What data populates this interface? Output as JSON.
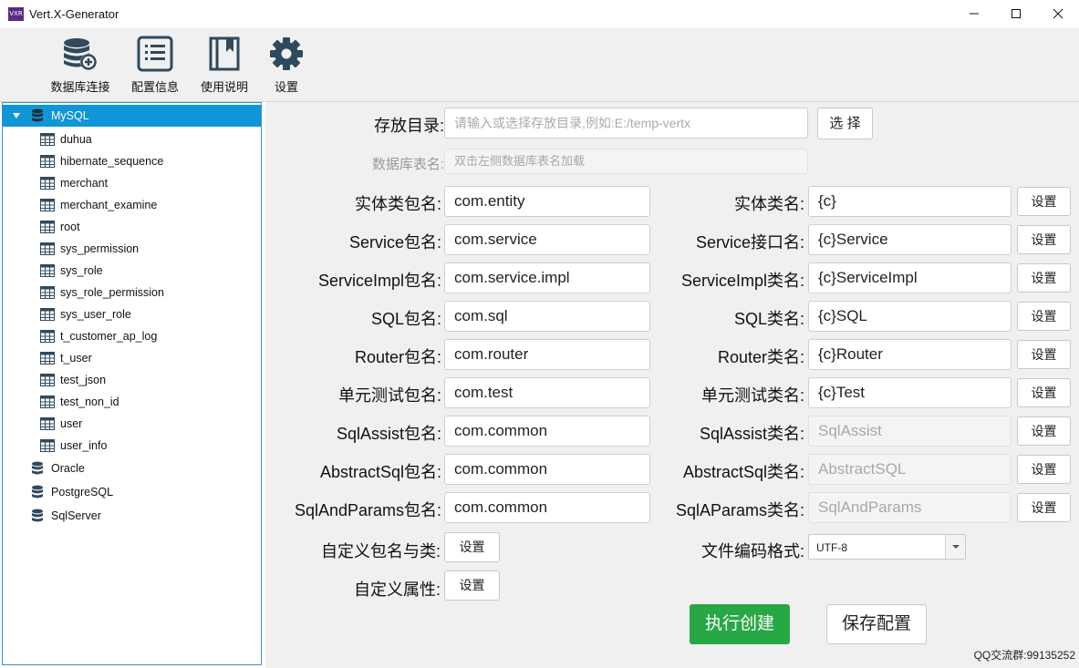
{
  "window": {
    "title": "Vert.X-Generator",
    "logo_text": "VXR"
  },
  "toolbar": [
    {
      "label": "数据库连接",
      "icon": "database-add-icon"
    },
    {
      "label": "配置信息",
      "icon": "list-icon"
    },
    {
      "label": "使用说明",
      "icon": "book-icon"
    },
    {
      "label": "设置",
      "icon": "gear-icon"
    }
  ],
  "tree": {
    "root": "MySQL",
    "tables": [
      "duhua",
      "hibernate_sequence",
      "merchant",
      "merchant_examine",
      "root",
      "sys_permission",
      "sys_role",
      "sys_role_permission",
      "sys_user_role",
      "t_customer_ap_log",
      "t_user",
      "test_json",
      "test_non_id",
      "user",
      "user_info"
    ],
    "others": [
      "Oracle",
      "PostgreSQL",
      "SqlServer"
    ]
  },
  "form": {
    "dir_label": "存放目录:",
    "dir_placeholder": "请输入或选择存放目录,例如:E:/temp-vertx",
    "choose_btn": "选 择",
    "table_label": "数据库表名:",
    "table_placeholder": "双击左侧数据库表名加载",
    "rows": [
      {
        "pkg_label": "实体类包名:",
        "pkg_value": "com.entity",
        "cls_label": "实体类名:",
        "cls_value": "{c}",
        "cls_disabled": false
      },
      {
        "pkg_label": "Service包名:",
        "pkg_value": "com.service",
        "cls_label": "Service接口名:",
        "cls_value": "{c}Service",
        "cls_disabled": false
      },
      {
        "pkg_label": "ServiceImpl包名:",
        "pkg_value": "com.service.impl",
        "cls_label": "ServiceImpl类名:",
        "cls_value": "{c}ServiceImpl",
        "cls_disabled": false
      },
      {
        "pkg_label": "SQL包名:",
        "pkg_value": "com.sql",
        "cls_label": "SQL类名:",
        "cls_value": "{c}SQL",
        "cls_disabled": false
      },
      {
        "pkg_label": "Router包名:",
        "pkg_value": "com.router",
        "cls_label": "Router类名:",
        "cls_value": "{c}Router",
        "cls_disabled": false
      },
      {
        "pkg_label": "单元测试包名:",
        "pkg_value": "com.test",
        "cls_label": "单元测试类名:",
        "cls_value": "{c}Test",
        "cls_disabled": false
      },
      {
        "pkg_label": "SqlAssist包名:",
        "pkg_value": "com.common",
        "cls_label": "SqlAssist类名:",
        "cls_value": "SqlAssist",
        "cls_disabled": true
      },
      {
        "pkg_label": "AbstractSql包名:",
        "pkg_value": "com.common",
        "cls_label": "AbstractSql类名:",
        "cls_value": "AbstractSQL",
        "cls_disabled": true
      },
      {
        "pkg_label": "SqlAndParams包名:",
        "pkg_value": "com.common",
        "cls_label": "SqlAParams类名:",
        "cls_value": "SqlAndParams",
        "cls_disabled": true
      }
    ],
    "set_btn": "设置",
    "custom_pkg_label": "自定义包名与类:",
    "encoding_label": "文件编码格式:",
    "encoding_value": "UTF-8",
    "custom_attr_label": "自定义属性:",
    "create_btn": "执行创建",
    "save_btn": "保存配置",
    "footer": "QQ交流群:99135252"
  },
  "colors": {
    "primary": "#28a745",
    "selection": "#0f96d6",
    "icon": "#2f4a5e"
  }
}
